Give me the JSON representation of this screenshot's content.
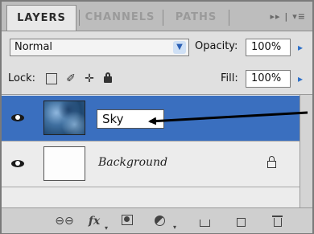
{
  "tabs": [
    {
      "label": "LAYERS",
      "active": true
    },
    {
      "label": "CHANNELS",
      "active": false
    },
    {
      "label": "PATHS",
      "active": false
    }
  ],
  "panel_menu_icons": "▸▸ | ▾≡",
  "blend": {
    "mode": "Normal",
    "opacity_label": "Opacity:",
    "opacity_value": "100%"
  },
  "lock": {
    "label": "Lock:",
    "fill_label": "Fill:",
    "fill_value": "100%",
    "icons": [
      "lock-transparent-pixels-icon",
      "lock-image-pixels-icon",
      "lock-position-icon",
      "lock-all-icon"
    ]
  },
  "layers": [
    {
      "name": "Sky",
      "selected": true,
      "visible": true,
      "editing": true
    },
    {
      "name": "Background",
      "selected": false,
      "visible": true,
      "locked": true
    }
  ],
  "bottom_tools": [
    "link-layers-icon",
    "fx-icon",
    "add-mask-icon",
    "adjustment-layer-icon",
    "new-group-icon",
    "new-layer-icon",
    "delete-layer-icon"
  ],
  "colors": {
    "selection": "#3a6fbf",
    "panel": "#d9d9d9",
    "arrow": "#000000"
  }
}
